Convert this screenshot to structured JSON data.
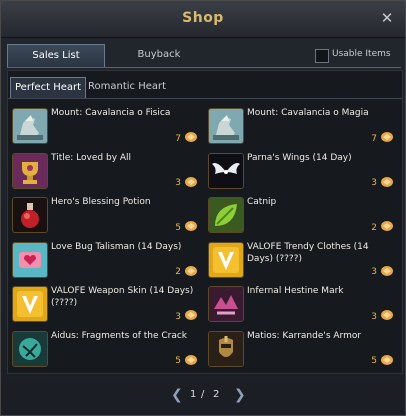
{
  "window": {
    "title": "Shop"
  },
  "tabs": {
    "sales_list": "Sales List",
    "buyback": "Buyback"
  },
  "usable_items": {
    "label": "Usable Items",
    "checked": false
  },
  "subtabs": {
    "perfect_heart": "Perfect Heart",
    "romantic_heart": "Romantic Heart"
  },
  "items": [
    {
      "name": "Mount: Cavalancia o Fisica",
      "price": "7",
      "icon": "horse-mount-icon"
    },
    {
      "name": "Mount: Cavalancia o Magia",
      "price": "7",
      "icon": "horse-mount-icon"
    },
    {
      "name": "Title: Loved by All",
      "price": "3",
      "icon": "trophy-icon"
    },
    {
      "name": "Parna's Wings (14 Day)",
      "price": "3",
      "icon": "wings-icon"
    },
    {
      "name": "Hero's Blessing Potion",
      "price": "5",
      "icon": "potion-icon"
    },
    {
      "name": "Catnip",
      "price": "2",
      "icon": "leaf-icon"
    },
    {
      "name": "Love Bug Talisman (14 Days)",
      "price": "2",
      "icon": "love-bug-icon"
    },
    {
      "name": "VALOFE Trendy Clothes (14 Days) (????)",
      "price": "3",
      "icon": "valofe-v-icon"
    },
    {
      "name": "VALOFE Weapon Skin (14 Days) (????)",
      "price": "3",
      "icon": "valofe-v-icon"
    },
    {
      "name": "Infernal Hestine Mark",
      "price": "3",
      "icon": "hestine-mark-icon"
    },
    {
      "name": "Aidus: Fragments of the Crack",
      "price": "5",
      "icon": "orb-fragment-icon"
    },
    {
      "name": "Matios: Karrande's Armor",
      "price": "5",
      "icon": "armor-icon"
    }
  ],
  "pager": {
    "current": "1",
    "separator": "/",
    "total": "2"
  }
}
